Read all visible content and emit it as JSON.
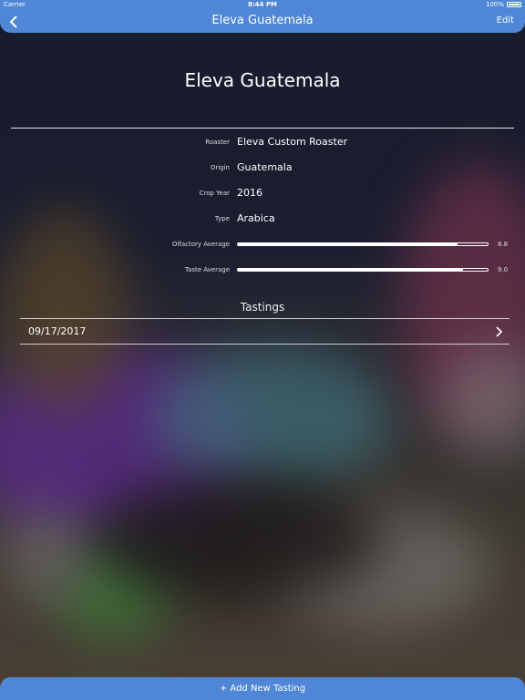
{
  "status_bar": {
    "carrier": "Carrier",
    "time": "8:44 PM",
    "battery": "100%"
  },
  "nav": {
    "title": "Eleva Guatemala",
    "edit_label": "Edit",
    "back_icon": "chevron-left-icon"
  },
  "coffee": {
    "name": "Eleva Guatemala"
  },
  "details": [
    {
      "label": "Roaster",
      "value": "Eleva Custom Roaster"
    },
    {
      "label": "Origin",
      "value": "Guatemala"
    },
    {
      "label": "Crop Year",
      "value": "2016"
    },
    {
      "label": "Type",
      "value": "Arabica"
    }
  ],
  "ratings": [
    {
      "label": "Olfactory Average",
      "value": "8.8",
      "fraction": 0.88
    },
    {
      "label": "Taste Average",
      "value": "9.0",
      "fraction": 0.9
    }
  ],
  "tastings": {
    "title": "Tastings",
    "items": [
      {
        "date": "09/17/2017"
      }
    ]
  },
  "add_button": {
    "label": "+ Add New Tasting"
  },
  "colors": {
    "accent": "#4f87d6",
    "background": "#1a1d2e"
  }
}
